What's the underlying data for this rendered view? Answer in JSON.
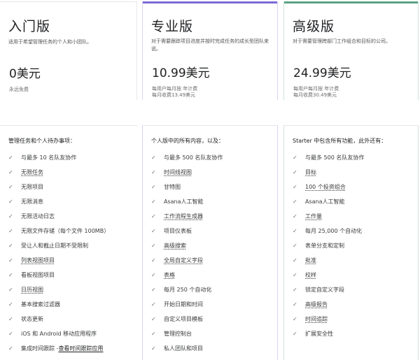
{
  "plans": [
    {
      "name": "入门版",
      "description": "适用于希望管理任务的个人和小团队。",
      "price": "0美元",
      "price_notes": [
        "永远免费"
      ],
      "features_title": "管理任务和个人待办事项：",
      "features": [
        {
          "text": "与最多 10 名队友协作",
          "link": false
        },
        {
          "text": "无限任务",
          "link": true
        },
        {
          "text": "无限项目",
          "link": false
        },
        {
          "text": "无限消息",
          "link": false
        },
        {
          "text": "无限活动日志",
          "link": false
        },
        {
          "text": "无限文件存储（每个文件 100MB）",
          "link": false
        },
        {
          "text": "受让人和截止日期不受限制",
          "link": false
        },
        {
          "text": "列表视图项目",
          "link": true
        },
        {
          "text": "看板视图项目",
          "link": false
        },
        {
          "text": "日历视图",
          "link": true
        },
        {
          "text": "基本搜索过滤器",
          "link": false
        },
        {
          "text": "状态更新",
          "link": false
        },
        {
          "text": "iOS 和 Android 移动应用程序",
          "link": false
        },
        {
          "text": "集成时间跟踪 -",
          "link": false,
          "extra": "查看时间跟踪应用"
        }
      ]
    },
    {
      "name": "专业版",
      "description": "对于需要跟踪项目进度并按时完成任务的成长型团队来说。",
      "price": "10.99美元",
      "price_notes": [
        "每用户每月按 年计费",
        "每月收费13.49美元"
      ],
      "features_title": "个人版中的所有内容，以及：",
      "features": [
        {
          "text": "与最多 500 名队友协作",
          "link": false
        },
        {
          "text": "时间线视图",
          "link": true
        },
        {
          "text": "甘特图",
          "link": false
        },
        {
          "text": "Asana人工智能",
          "link": false
        },
        {
          "text": "工作流程生成器",
          "link": true
        },
        {
          "text": "项目仪表板",
          "link": false
        },
        {
          "text": "高级搜索",
          "link": true
        },
        {
          "text": "全局自定义字段",
          "link": true
        },
        {
          "text": "表格",
          "link": true
        },
        {
          "text": "每月 250 个自动化",
          "link": false
        },
        {
          "text": "开始日期和时间",
          "link": false
        },
        {
          "text": "自定义项目模板",
          "link": false
        },
        {
          "text": "管理控制台",
          "link": false
        },
        {
          "text": "私人团队和项目",
          "link": false
        }
      ]
    },
    {
      "name": "高级版",
      "description": "对于需要管理跨部门工作组合和目标的公司。",
      "price": "24.99美元",
      "price_notes": [
        "每用户每月按 年计费",
        "每月收费30.49美元"
      ],
      "features_title": "Starter 中包含所有功能，此外还有：",
      "features": [
        {
          "text": "与最多 500 名队友协作",
          "link": false
        },
        {
          "text": "目标",
          "link": true
        },
        {
          "text": "100 个投资组合",
          "link": true
        },
        {
          "text": "Asana人工智能",
          "link": false
        },
        {
          "text": "工作量",
          "link": true
        },
        {
          "text": "每月 25,000 个自动化",
          "link": false
        },
        {
          "text": "表单分支和定制",
          "link": false
        },
        {
          "text": "批准",
          "link": true
        },
        {
          "text": "校样",
          "link": true
        },
        {
          "text": "锁定自定义字段",
          "link": false
        },
        {
          "text": "高级报告",
          "link": true
        },
        {
          "text": "时间追踪",
          "link": true
        },
        {
          "text": "扩展安全性",
          "link": false
        }
      ]
    }
  ],
  "check_glyph": "✓",
  "colors": {
    "pro_accent": "#7c6ad6",
    "business_accent": "#5aa383"
  }
}
